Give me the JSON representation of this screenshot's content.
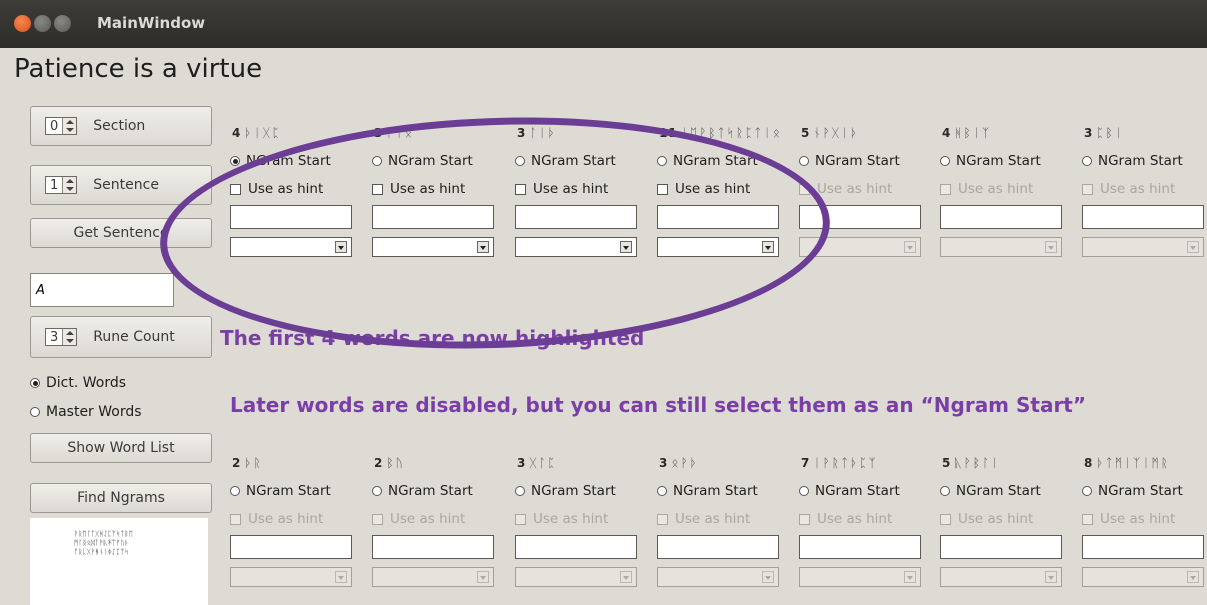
{
  "window": {
    "title": "MainWindow"
  },
  "page": {
    "heading": "Patience is a virtue"
  },
  "sidebar": {
    "section_value": "0",
    "section_label": "Section",
    "sentence_value": "1",
    "sentence_label": "Sentence",
    "get_sentence_label": "Get Sentence",
    "text_input_value": "A",
    "rune_count_value": "3",
    "rune_count_label": "Rune Count",
    "dict_words_label": "Dict. Words",
    "master_words_label": "Master Words",
    "show_word_list_label": "Show Word List",
    "find_ngrams_label": "Find Ngrams",
    "preview_text": "ᚹᚱᛖᛚᛏᚷᚻᛇᛈᛉᛋᛏᛒᛖ\nᛗᛚᛝᛟᛞᚪᚫᚣᛡᛠᚠᚢᚦ\nᚩᚱᚳᚷᚹᚻᚾᛁᛄᛇᛈᛉᛋ"
  },
  "labels": {
    "ngram_start": "NGram Start",
    "use_as_hint": "Use as hint"
  },
  "row1": [
    {
      "count": "4",
      "runes": "ᚦᛁᚷᛈ",
      "ngram_checked": true,
      "enabled": true
    },
    {
      "count": "3",
      "runes": "ᚠᛁᛟ",
      "ngram_checked": false,
      "enabled": true
    },
    {
      "count": "3",
      "runes": "ᛚᛁᚦ",
      "ngram_checked": false,
      "enabled": true
    },
    {
      "count": "11",
      "runes": "ᛁᛖᚹᛒᛏᛋᚱᛈᛏᛁᛟ",
      "ngram_checked": false,
      "enabled": true
    },
    {
      "count": "5",
      "runes": "ᚾᚹᚷᛁᚦ",
      "ngram_checked": false,
      "enabled": false
    },
    {
      "count": "4",
      "runes": "ᚻᛒᛁᛉ",
      "ngram_checked": false,
      "enabled": false
    },
    {
      "count": "3",
      "runes": "ᛈᛒᛁ",
      "ngram_checked": false,
      "enabled": false
    }
  ],
  "row2": [
    {
      "count": "2",
      "runes": "ᚦᚱ",
      "ngram_checked": false,
      "enabled": false
    },
    {
      "count": "2",
      "runes": "ᛒᚢ",
      "ngram_checked": false,
      "enabled": false
    },
    {
      "count": "3",
      "runes": "ᚷᛚᛈ",
      "ngram_checked": false,
      "enabled": false
    },
    {
      "count": "3",
      "runes": "ᛟᚹᚦ",
      "ngram_checked": false,
      "enabled": false
    },
    {
      "count": "7",
      "runes": "ᛁᚹᚱᛏᚦᛈᛉ",
      "ngram_checked": false,
      "enabled": false
    },
    {
      "count": "5",
      "runes": "ᚣᚹᛒᛚᛁ",
      "ngram_checked": false,
      "enabled": false
    },
    {
      "count": "8",
      "runes": "ᚦᛏᛗᛁᛉᛁᛗᚱ",
      "ngram_checked": false,
      "enabled": false
    }
  ],
  "annotations": {
    "line1": "The first 4 words are now highlighted",
    "line2": "Later words are disabled, but you can still select them as an “Ngram Start”"
  },
  "colors": {
    "annotation": "#7a3fa6",
    "ellipse": "#6b3d94"
  }
}
